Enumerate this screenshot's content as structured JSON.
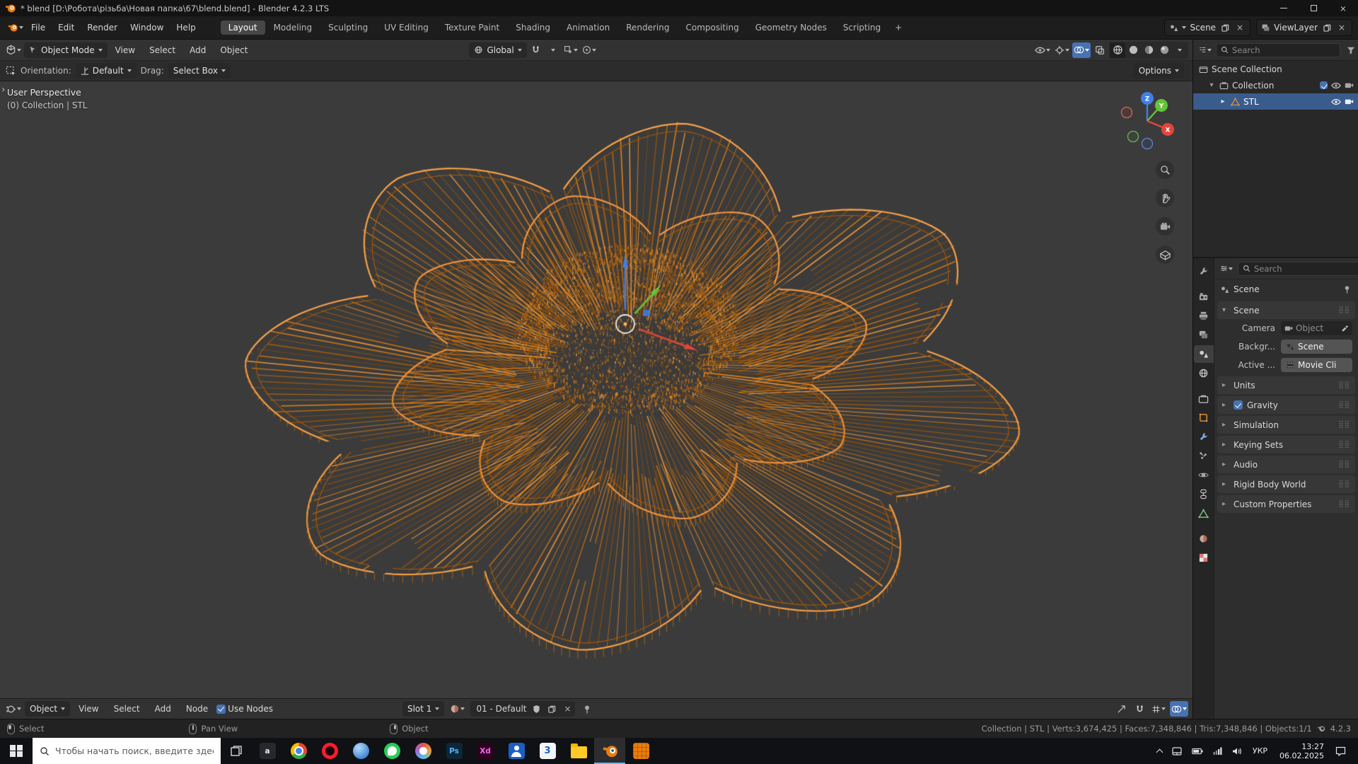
{
  "colors": {
    "viewport_bg": "#3b3b3b",
    "wire_orange": "#e8820e",
    "wire_bright": "#f9a148",
    "accent_blue": "#4772b3",
    "axis_x": "#e2453c",
    "axis_y": "#65c23a",
    "axis_z": "#3f7fe8"
  },
  "titlebar": {
    "title": "* blend [D:\\Робота\\різьба\\Новая папка\\67\\blend.blend] - Blender 4.2.3 LTS"
  },
  "menubar": {
    "menus": [
      "File",
      "Edit",
      "Render",
      "Window",
      "Help"
    ],
    "workspaces": [
      "Layout",
      "Modeling",
      "Sculpting",
      "UV Editing",
      "Texture Paint",
      "Shading",
      "Animation",
      "Rendering",
      "Compositing",
      "Geometry Nodes",
      "Scripting"
    ],
    "add_workspace": "+",
    "scene_selector": "Scene",
    "view_layer_selector": "ViewLayer"
  },
  "tool_header": {
    "mode": "Object Mode",
    "menus": [
      "View",
      "Select",
      "Add",
      "Object"
    ],
    "orientation": "Global"
  },
  "tool_settings": {
    "orientation_label": "Orientation:",
    "orientation_value": "Default",
    "drag_label": "Drag:",
    "drag_value": "Select Box",
    "options": "Options"
  },
  "viewport": {
    "perspective_label": "User Perspective",
    "context_label": "(0) Collection | STL",
    "nav_axes": {
      "x": "X",
      "y": "Y",
      "z": "Z"
    }
  },
  "outliner": {
    "search_placeholder": "Search",
    "rows": [
      {
        "label": "Scene Collection"
      },
      {
        "label": "Collection"
      },
      {
        "label": "STL"
      }
    ]
  },
  "properties": {
    "search_placeholder": "Search",
    "breadcrumb": "Scene",
    "tabs": [
      "tool",
      "render",
      "output",
      "view-layer",
      "scene",
      "world",
      "collection",
      "object",
      "modifiers",
      "particles",
      "physics",
      "constraints",
      "object-data",
      "material",
      "texture"
    ],
    "active_tab": "scene",
    "scene_panel": {
      "title": "Scene",
      "camera_label": "Camera",
      "camera_value": "Object",
      "background_label": "Backgr...",
      "background_value": "Scene",
      "active_clip_label": "Active ...",
      "active_clip_value": "Movie Cli"
    },
    "sections": [
      "Units",
      "Gravity",
      "Simulation",
      "Keying Sets",
      "Audio",
      "Rigid Body World",
      "Custom Properties"
    ],
    "gravity_enabled": true
  },
  "shader_editor": {
    "mode": "Object",
    "menus": [
      "View",
      "Select",
      "Add",
      "Node"
    ],
    "use_nodes_label": "Use Nodes",
    "use_nodes_checked": true,
    "slot": "Slot 1",
    "material_name": "01 - Default"
  },
  "statusbar": {
    "hints": [
      {
        "label": "Select"
      },
      {
        "label": "Pan View"
      },
      {
        "label": "Object"
      }
    ],
    "stats": "Collection | STL | Verts:3,674,425 | Faces:7,348,846 | Tris:7,348,846 | Objects:1/1",
    "version": "4.2.3"
  },
  "taskbar": {
    "search_placeholder": "Чтобы начать поиск, введите здесь запрос",
    "apps": [
      "app-dark",
      "chrome",
      "opera",
      "viewer",
      "whatsapp",
      "itunes",
      "photoshop",
      "xd",
      "contacts",
      "app-3",
      "explorer",
      "blender",
      "blender-asset"
    ],
    "tray": {
      "language": "УКР",
      "time": "13:27",
      "date": "06.02.2025"
    }
  }
}
